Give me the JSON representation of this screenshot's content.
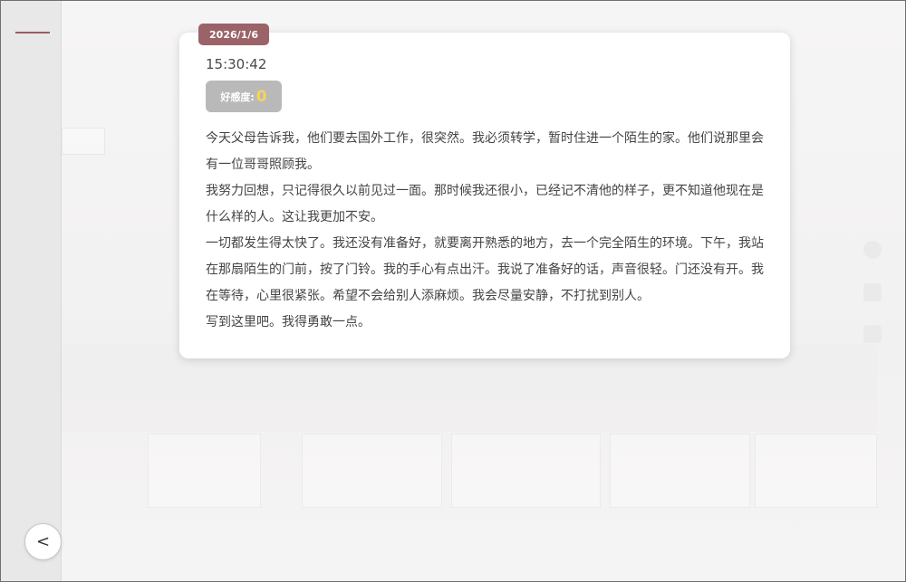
{
  "diary": {
    "date": "2026/1/6",
    "time": "15:30:42",
    "affection_label": "好感度:",
    "affection_value": "0",
    "paragraphs": [
      "今天父母告诉我，他们要去国外工作，很突然。我必须转学，暂时住进一个陌生的家。他们说那里会有一位哥哥照顾我。",
      "我努力回想，只记得很久以前见过一面。那时候我还很小，已经记不清他的样子，更不知道他现在是什么样的人。这让我更加不安。",
      "一切都发生得太快了。我还没有准备好，就要离开熟悉的地方，去一个完全陌生的环境。下午，我站在那扇陌生的门前，按了门铃。我的手心有点出汗。我说了准备好的话，声音很轻。门还没有开。我在等待，心里很紧张。希望不会给别人添麻烦。我会尽量安静，不打扰到别人。",
      "写到这里吧。我得勇敢一点。"
    ]
  },
  "nav": {
    "back_label": "<"
  },
  "colors": {
    "accent": "#9b6368",
    "affection_value": "#f7d45a",
    "badge_bg": "#b9b9b9"
  },
  "icons": {
    "menu": "menu-line-icon",
    "back": "back-arrow-icon"
  }
}
